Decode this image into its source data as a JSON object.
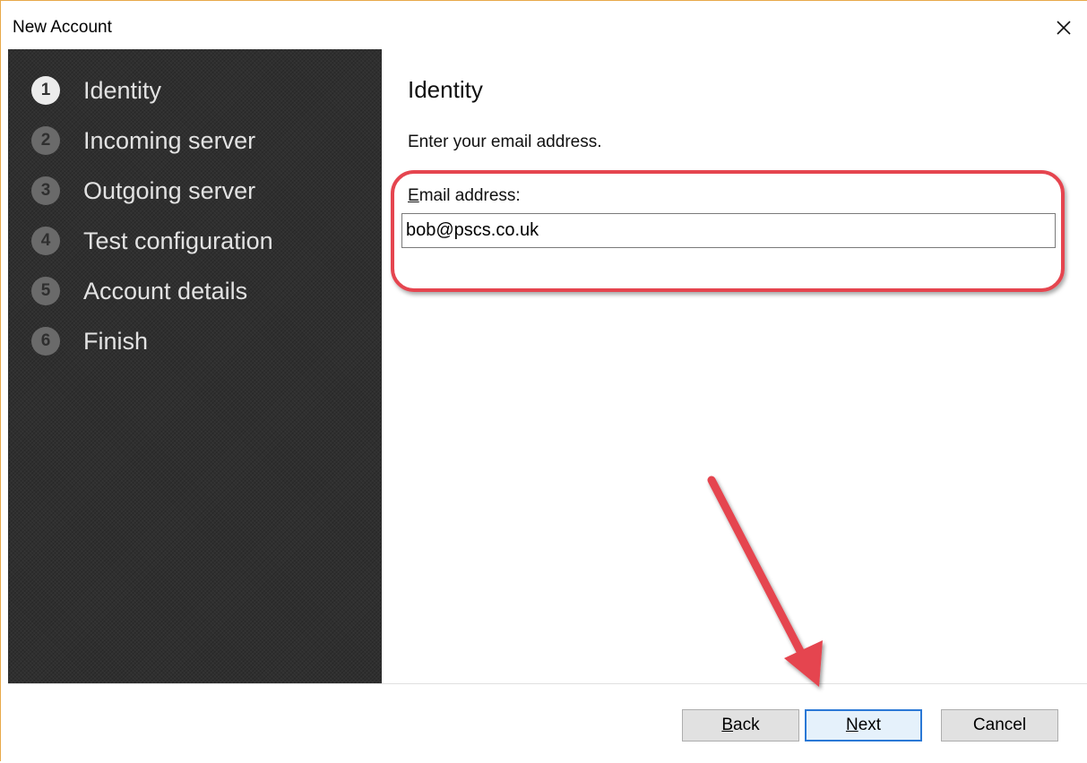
{
  "window": {
    "title": "New Account"
  },
  "sidebar": {
    "steps": [
      {
        "num": "1",
        "label": "Identity",
        "active": true
      },
      {
        "num": "2",
        "label": "Incoming server",
        "active": false
      },
      {
        "num": "3",
        "label": "Outgoing server",
        "active": false
      },
      {
        "num": "4",
        "label": "Test configuration",
        "active": false
      },
      {
        "num": "5",
        "label": "Account details",
        "active": false
      },
      {
        "num": "6",
        "label": "Finish",
        "active": false
      }
    ]
  },
  "main": {
    "heading": "Identity",
    "instruction": "Enter your email address.",
    "email_label_first": "E",
    "email_label_rest": "mail address:",
    "email_value": "bob@pscs.co.uk"
  },
  "footer": {
    "back_first": "B",
    "back_rest": "ack",
    "next_first": "N",
    "next_rest": "ext",
    "cancel_label": "Cancel"
  },
  "colors": {
    "accent": "#2a78d6",
    "annotation": "#e5454f",
    "sidebar_bg": "#2f2f2f"
  },
  "icons": {
    "close": "close-icon",
    "annotation_arrow": "arrow-annotation"
  }
}
